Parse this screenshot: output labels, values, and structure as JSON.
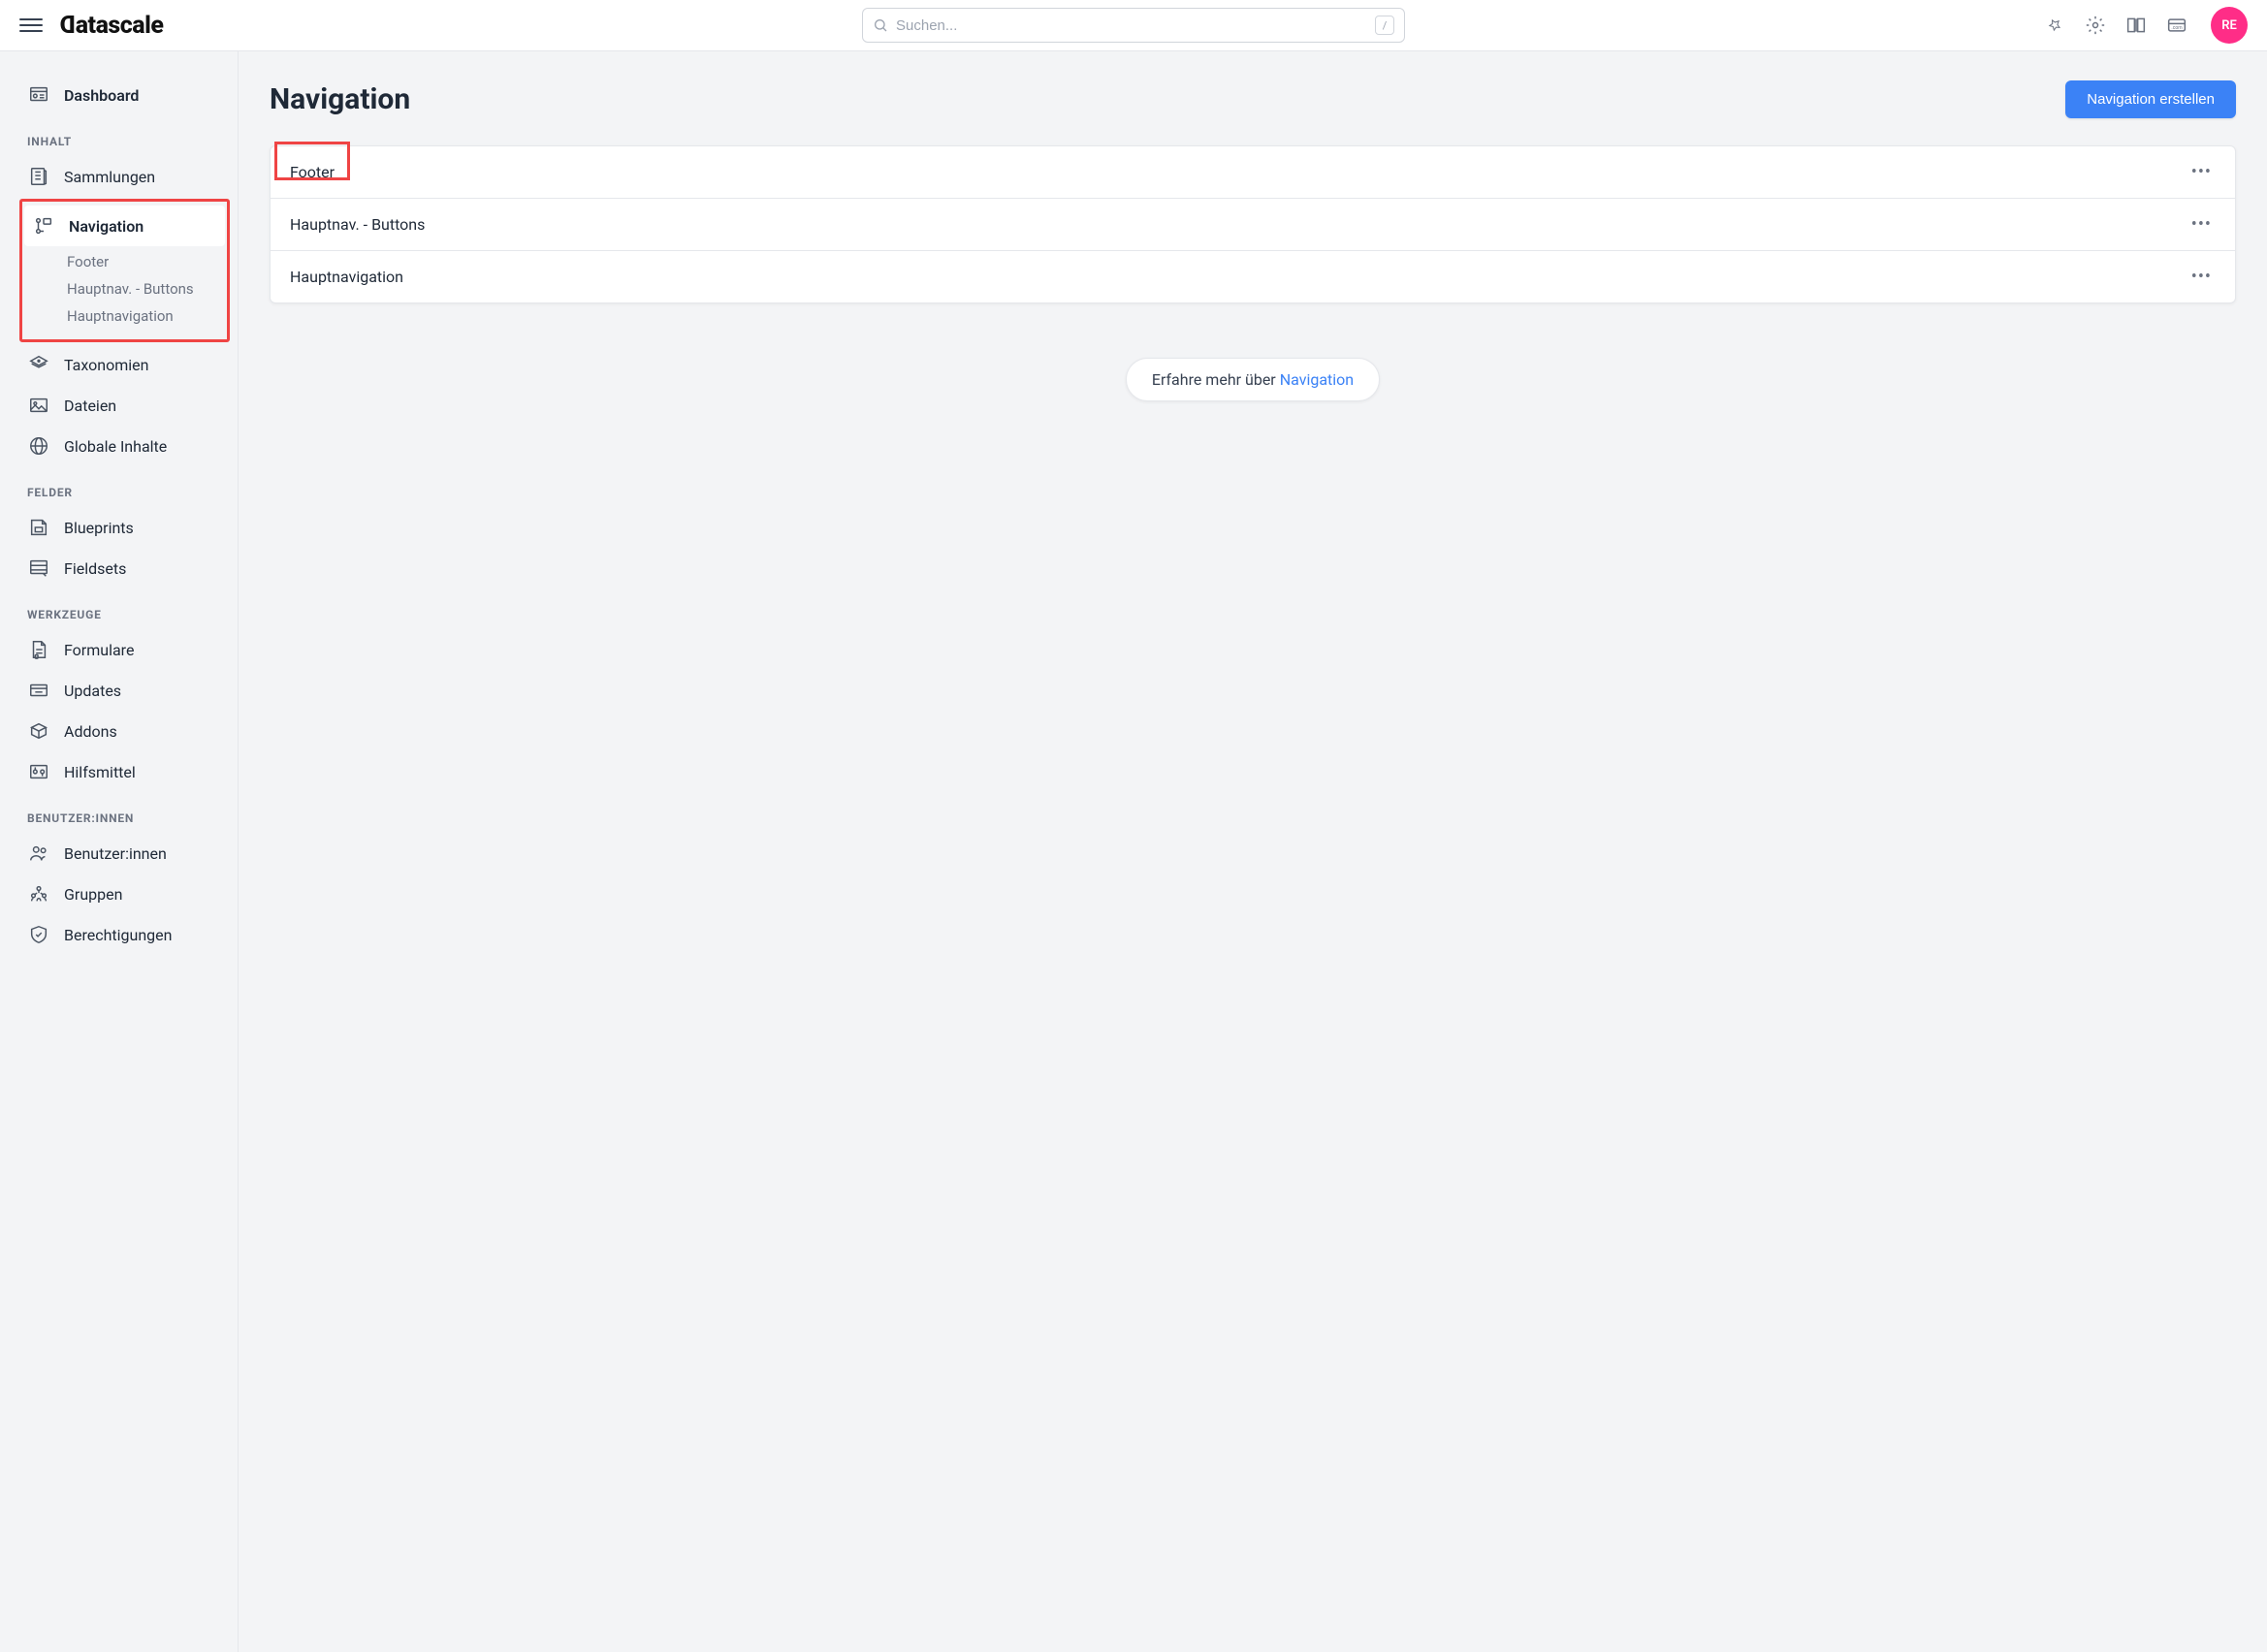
{
  "brand": "Datascale",
  "search": {
    "placeholder": "Suchen...",
    "kbd": "/"
  },
  "avatar": "RE",
  "sidebar": {
    "dashboard": "Dashboard",
    "sections": {
      "inhalt": {
        "label": "INHALT",
        "items": {
          "sammlungen": "Sammlungen",
          "navigation": "Navigation",
          "nav_subs": [
            "Footer",
            "Hauptnav. - Buttons",
            "Hauptnavigation"
          ],
          "taxonomien": "Taxonomien",
          "dateien": "Dateien",
          "globale": "Globale Inhalte"
        }
      },
      "felder": {
        "label": "FELDER",
        "items": {
          "blueprints": "Blueprints",
          "fieldsets": "Fieldsets"
        }
      },
      "werkzeuge": {
        "label": "WERKZEUGE",
        "items": {
          "formulare": "Formulare",
          "updates": "Updates",
          "addons": "Addons",
          "hilfsmittel": "Hilfsmittel"
        }
      },
      "benutzer": {
        "label": "BENUTZER:INNEN",
        "items": {
          "benutzer": "Benutzer:innen",
          "gruppen": "Gruppen",
          "berechtigungen": "Berechtigungen"
        }
      }
    }
  },
  "page": {
    "title": "Navigation",
    "create_btn": "Navigation erstellen",
    "rows": [
      "Footer",
      "Hauptnav. - Buttons",
      "Hauptnavigation"
    ],
    "info_prefix": "Erfahre mehr über ",
    "info_link": "Navigation"
  }
}
